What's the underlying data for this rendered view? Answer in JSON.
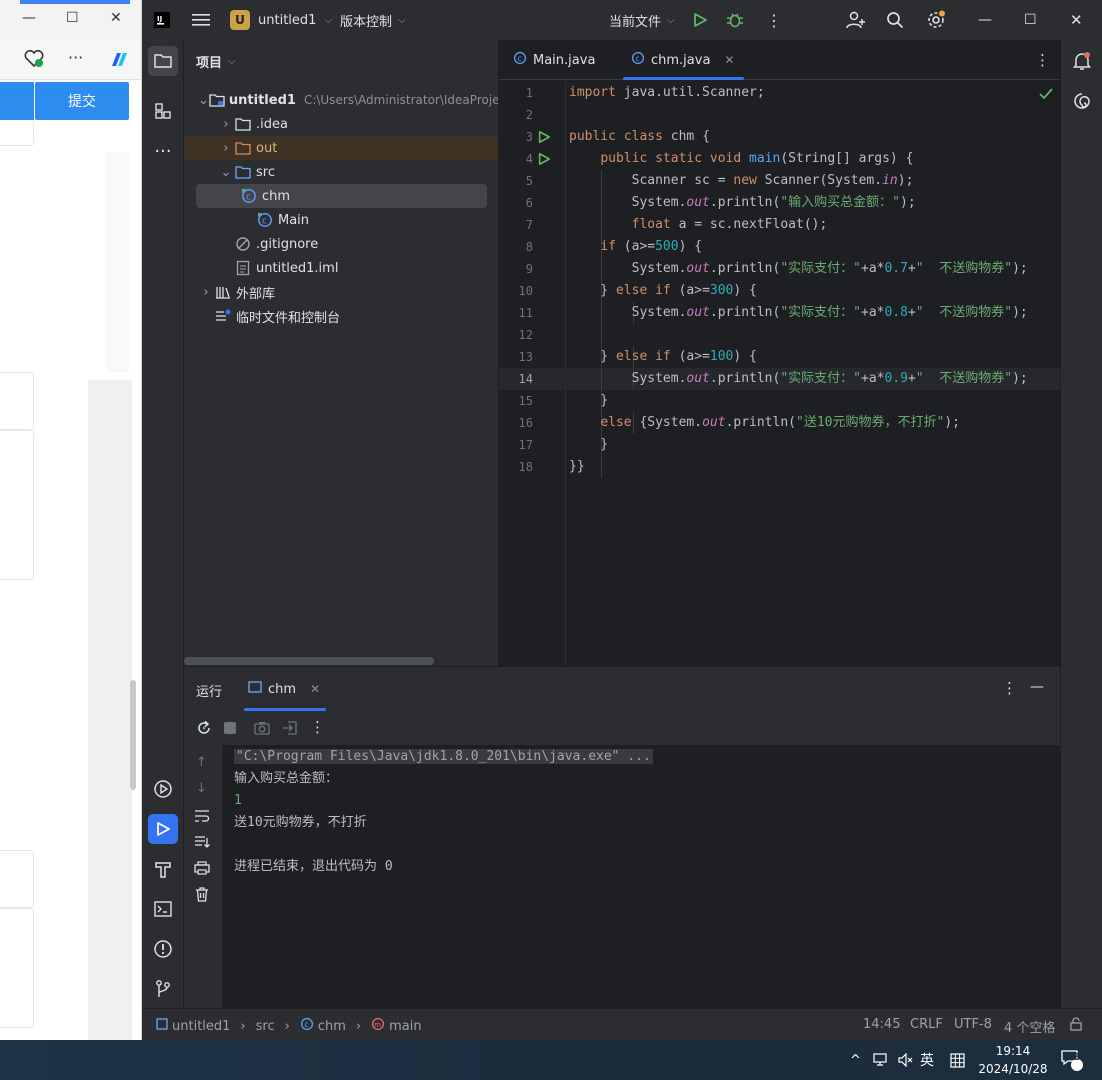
{
  "browser": {
    "submit_label": "提交",
    "toolbar_more": "···"
  },
  "ide": {
    "project_badge": "U",
    "project_name": "untitled1",
    "vcs_label": "版本控制",
    "run_config": "当前文件",
    "project_panel": {
      "title": "项目",
      "tree": [
        {
          "label": "untitled1",
          "hint": "C:\\Users\\Administrator\\IdeaProjec",
          "type": "module",
          "depth": 0,
          "expanded": true
        },
        {
          "label": ".idea",
          "type": "folder",
          "depth": 1,
          "expanded": false
        },
        {
          "label": "out",
          "type": "folder-excluded",
          "depth": 1,
          "expanded": false
        },
        {
          "label": "src",
          "type": "folder-source",
          "depth": 1,
          "expanded": true
        },
        {
          "label": "chm",
          "type": "java-class",
          "depth": 2,
          "selected": true
        },
        {
          "label": "Main",
          "type": "java-class",
          "depth": 2
        },
        {
          "label": ".gitignore",
          "type": "ignore-file",
          "depth": 1
        },
        {
          "label": "untitled1.iml",
          "type": "iml-file",
          "depth": 1
        },
        {
          "label": "外部库",
          "type": "libraries",
          "depth": 0,
          "expanded": false
        },
        {
          "label": "临时文件和控制台",
          "type": "scratches",
          "depth": 0
        }
      ]
    },
    "editor": {
      "tabs": [
        {
          "label": "Main.java",
          "active": false
        },
        {
          "label": "chm.java",
          "active": true
        }
      ],
      "current_line": 14,
      "line_numbers": [
        "1",
        "2",
        "3",
        "4",
        "5",
        "6",
        "7",
        "8",
        "9",
        "10",
        "11",
        "12",
        "13",
        "14",
        "15",
        "16",
        "17",
        "18"
      ],
      "code_lines": [
        "import java.util.Scanner;",
        "",
        "public class chm {",
        "    public static void main(String[] args) {",
        "        Scanner sc = new Scanner(System.in);",
        "        System.out.println(\"输入购买总金额：\");",
        "        float a = sc.nextFloat();",
        "    if (a>=500) {",
        "        System.out.println(\"实际支付：\"+a*0.7+\"  不送购物券\");",
        "    } else if (a>=300) {",
        "        System.out.println(\"实际支付：\"+a*0.8+\"  不送购物券\");",
        "",
        "    } else if (a>=100) {",
        "        System.out.println(\"实际支付：\"+a*0.9+\"  不送购物券\");",
        "    }",
        "    else {System.out.println(\"送10元购物券，不打折\");",
        "    }",
        "}}"
      ]
    },
    "run_panel": {
      "title": "运行",
      "tab_label": "chm",
      "console_lines": [
        "\"C:\\Program Files\\Java\\jdk1.8.0_201\\bin\\java.exe\" ...",
        "输入购买总金额：",
        "1",
        "送10元购物券，不打折",
        "",
        "进程已结束，退出代码为 0"
      ]
    },
    "status_bar": {
      "breadcrumb": [
        "untitled1",
        "src",
        "chm",
        "main"
      ],
      "position": "14:45",
      "line_sep": "CRLF",
      "encoding": "UTF-8",
      "indent": "4 个空格"
    }
  },
  "taskbar": {
    "ime": "英",
    "time": "19:14",
    "date": "2024/10/28",
    "notifications": "3"
  },
  "colors": {
    "accent": "#3574f0",
    "editor_bg": "#1e1f22",
    "panel_bg": "#2b2d30",
    "keyword": "#cf8e6d",
    "string": "#6aab73",
    "number": "#2aacb8",
    "method": "#56a8f5",
    "field": "#c77dbb",
    "submit_button": "#2d8cf0"
  }
}
